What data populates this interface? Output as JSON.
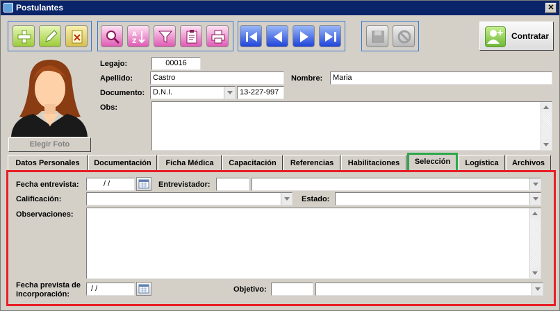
{
  "window": {
    "title": "Postulantes",
    "close_glyph": "✕"
  },
  "toolbar": {
    "group1": [
      "add-icon",
      "edit-icon",
      "delete-icon"
    ],
    "group2": [
      "search-icon",
      "sort-icon",
      "filter-icon",
      "clipboard-icon",
      "print-icon"
    ],
    "group3": [
      "first-record-icon",
      "prev-record-icon",
      "next-record-icon",
      "last-record-icon"
    ],
    "group4": [
      "save-icon",
      "cancel-icon"
    ],
    "contratar_label": "Contratar"
  },
  "photo": {
    "button_label": "Elegir Foto"
  },
  "header": {
    "legajo_label": "Legajo:",
    "legajo_value": "00016",
    "apellido_label": "Apellido:",
    "apellido_value": "Castro",
    "nombre_label": "Nombre:",
    "nombre_value": "Maria",
    "documento_label": "Documento:",
    "documento_tipo": "D.N.I.",
    "documento_numero": "13-227-997",
    "obs_label": "Obs:"
  },
  "tabs": [
    {
      "label": "Datos Personales"
    },
    {
      "label": "Documentación"
    },
    {
      "label": "Ficha Médica"
    },
    {
      "label": "Capacitación"
    },
    {
      "label": "Referencias"
    },
    {
      "label": "Habilitaciones"
    },
    {
      "label": "Selección",
      "active": true
    },
    {
      "label": "Logística"
    },
    {
      "label": "Archivos"
    }
  ],
  "seleccion": {
    "fecha_entrevista_label": "Fecha entrevista:",
    "fecha_entrevista_value": "/ /",
    "entrevistador_label": "Entrevistador:",
    "calificacion_label": "Calificación:",
    "estado_label": "Estado:",
    "observaciones_label": "Observaciones:",
    "fecha_prevista_label_1": "Fecha prevista de",
    "fecha_prevista_label_2": "incorporación:",
    "fecha_prevista_value": "/ /",
    "objetivo_label": "Objetivo:"
  },
  "colors": {
    "highlight_tab": "#2ea84c",
    "highlight_panel": "#e81e25",
    "title_bar": "#0a246a"
  }
}
